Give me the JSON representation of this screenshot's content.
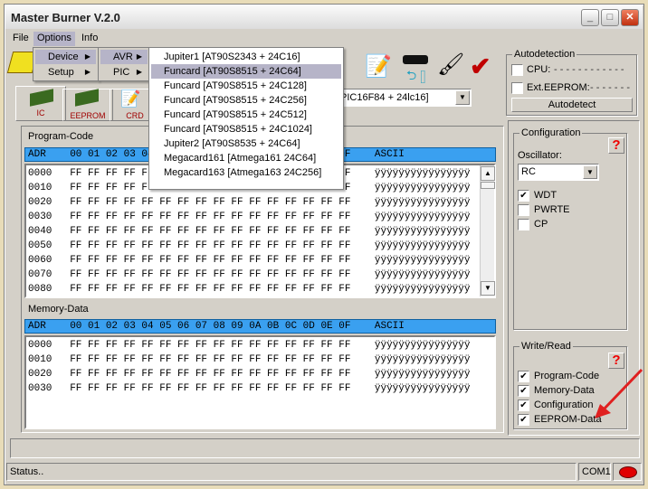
{
  "window": {
    "title": "Master Burner V.2.0"
  },
  "menubar": [
    "File",
    "Options",
    "Info"
  ],
  "options_menu": [
    {
      "label": "Device",
      "highlighted": true
    },
    {
      "label": "Setup"
    }
  ],
  "device_menu": [
    {
      "label": "AVR",
      "highlighted": true
    },
    {
      "label": "PIC"
    }
  ],
  "avr_menu": [
    {
      "label": "Jupiter1 [AT90S2343 + 24C16]"
    },
    {
      "label": "Funcard [AT90S8515 + 24C64]",
      "highlighted": true
    },
    {
      "label": "Funcard [AT90S8515 + 24C128]"
    },
    {
      "label": "Funcard [AT90S8515 + 24C256]"
    },
    {
      "label": "Funcard [AT90S8515 + 24C512]"
    },
    {
      "label": "Funcard [AT90S8515 + 24C1024]"
    },
    {
      "label": "Jupiter2 [AT90S8535 + 24C64]"
    },
    {
      "label": "Megacard161 [Atmega161 24C64]"
    },
    {
      "label": "Megacard163 [Atmega163 24C256]"
    }
  ],
  "tabs": [
    "IC",
    "EEPROM",
    "CRD"
  ],
  "device_combo": "PIC16F84 + 24lc16]",
  "program_code": {
    "label": "Program-Code",
    "header": "ADR    00 01 02 03 04 05 06 07 08 09 0A 0B 0C 0D 0E 0F    ASCII",
    "rows": [
      "0000   FF FF FF FF FF FF FF FF FF FF FF FF FF FF FF FF    ÿÿÿÿÿÿÿÿÿÿÿÿÿÿÿÿ",
      "0010   FF FF FF FF FF FF FF FF FF FF FF FF FF FF FF FF    ÿÿÿÿÿÿÿÿÿÿÿÿÿÿÿÿ",
      "0020   FF FF FF FF FF FF FF FF FF FF FF FF FF FF FF FF    ÿÿÿÿÿÿÿÿÿÿÿÿÿÿÿÿ",
      "0030   FF FF FF FF FF FF FF FF FF FF FF FF FF FF FF FF    ÿÿÿÿÿÿÿÿÿÿÿÿÿÿÿÿ",
      "0040   FF FF FF FF FF FF FF FF FF FF FF FF FF FF FF FF    ÿÿÿÿÿÿÿÿÿÿÿÿÿÿÿÿ",
      "0050   FF FF FF FF FF FF FF FF FF FF FF FF FF FF FF FF    ÿÿÿÿÿÿÿÿÿÿÿÿÿÿÿÿ",
      "0060   FF FF FF FF FF FF FF FF FF FF FF FF FF FF FF FF    ÿÿÿÿÿÿÿÿÿÿÿÿÿÿÿÿ",
      "0070   FF FF FF FF FF FF FF FF FF FF FF FF FF FF FF FF    ÿÿÿÿÿÿÿÿÿÿÿÿÿÿÿÿ",
      "0080   FF FF FF FF FF FF FF FF FF FF FF FF FF FF FF FF    ÿÿÿÿÿÿÿÿÿÿÿÿÿÿÿÿ"
    ]
  },
  "memory_data": {
    "label": "Memory-Data",
    "header": "ADR    00 01 02 03 04 05 06 07 08 09 0A 0B 0C 0D 0E 0F    ASCII",
    "rows": [
      "0000   FF FF FF FF FF FF FF FF FF FF FF FF FF FF FF FF    ÿÿÿÿÿÿÿÿÿÿÿÿÿÿÿÿ",
      "0010   FF FF FF FF FF FF FF FF FF FF FF FF FF FF FF FF    ÿÿÿÿÿÿÿÿÿÿÿÿÿÿÿÿ",
      "0020   FF FF FF FF FF FF FF FF FF FF FF FF FF FF FF FF    ÿÿÿÿÿÿÿÿÿÿÿÿÿÿÿÿ",
      "0030   FF FF FF FF FF FF FF FF FF FF FF FF FF FF FF FF    ÿÿÿÿÿÿÿÿÿÿÿÿÿÿÿÿ"
    ]
  },
  "autodetection": {
    "label": "Autodetection",
    "cpu_label": "CPU:",
    "cpu_value": "- - - - - - - - - - - -",
    "eeprom_label": "Ext.EEPROM:",
    "eeprom_value": "- - - - - - -",
    "button": "Autodetect",
    "cpu_checked": false,
    "eeprom_checked": false
  },
  "configuration": {
    "label": "Configuration",
    "oscillator_label": "Oscillator:",
    "oscillator_value": "RC",
    "options": [
      {
        "label": "WDT",
        "checked": true
      },
      {
        "label": "PWRTE",
        "checked": false
      },
      {
        "label": "CP",
        "checked": false
      }
    ],
    "help": "?"
  },
  "write_read": {
    "label": "Write/Read",
    "help": "?",
    "options": [
      {
        "label": "Program-Code",
        "checked": true
      },
      {
        "label": "Memory-Data",
        "checked": true
      },
      {
        "label": "Configuration",
        "checked": true
      },
      {
        "label": "EEPROM-Data",
        "checked": true
      }
    ]
  },
  "status": {
    "text": "Status..",
    "port": "COM1",
    "led_color": "#e00000"
  },
  "colors": {
    "hex_header": "#3aa0f0",
    "menu_highlight": "#b6b4c8",
    "arrow": "#e02020"
  }
}
